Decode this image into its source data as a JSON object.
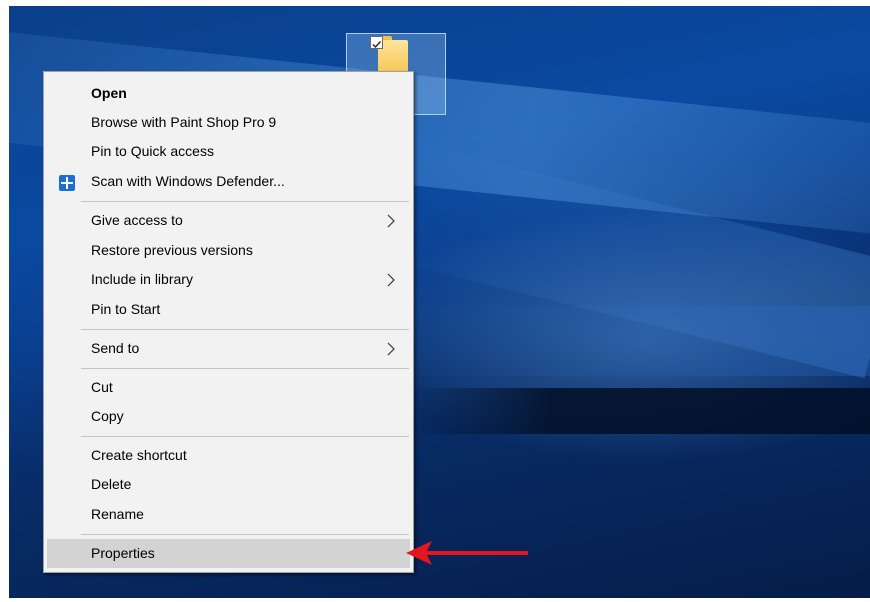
{
  "desktop": {
    "icon": {
      "name": "folder-icon",
      "checkbox": "checked"
    }
  },
  "menu": {
    "groups": [
      {
        "items": [
          {
            "label": "Open",
            "bold": true
          },
          {
            "label": "Browse with Paint Shop Pro 9"
          },
          {
            "label": "Pin to Quick access"
          },
          {
            "label": "Scan with Windows Defender...",
            "icon": "windows-defender-icon"
          }
        ]
      },
      {
        "items": [
          {
            "label": "Give access to",
            "submenu": true
          },
          {
            "label": "Restore previous versions"
          },
          {
            "label": "Include in library",
            "submenu": true
          },
          {
            "label": "Pin to Start"
          }
        ]
      },
      {
        "items": [
          {
            "label": "Send to",
            "submenu": true
          }
        ]
      },
      {
        "items": [
          {
            "label": "Cut"
          },
          {
            "label": "Copy"
          }
        ]
      },
      {
        "items": [
          {
            "label": "Create shortcut"
          },
          {
            "label": "Delete"
          },
          {
            "label": "Rename"
          }
        ]
      },
      {
        "items": [
          {
            "label": "Properties",
            "highlighted": true
          }
        ]
      }
    ]
  },
  "annotation": {
    "arrow_color": "#e3161e",
    "points_to": "Properties"
  },
  "colors": {
    "menu_bg": "#f2f2f2",
    "hover_bg": "#d3d3d3",
    "defender_blue": "#1c6fd1"
  }
}
